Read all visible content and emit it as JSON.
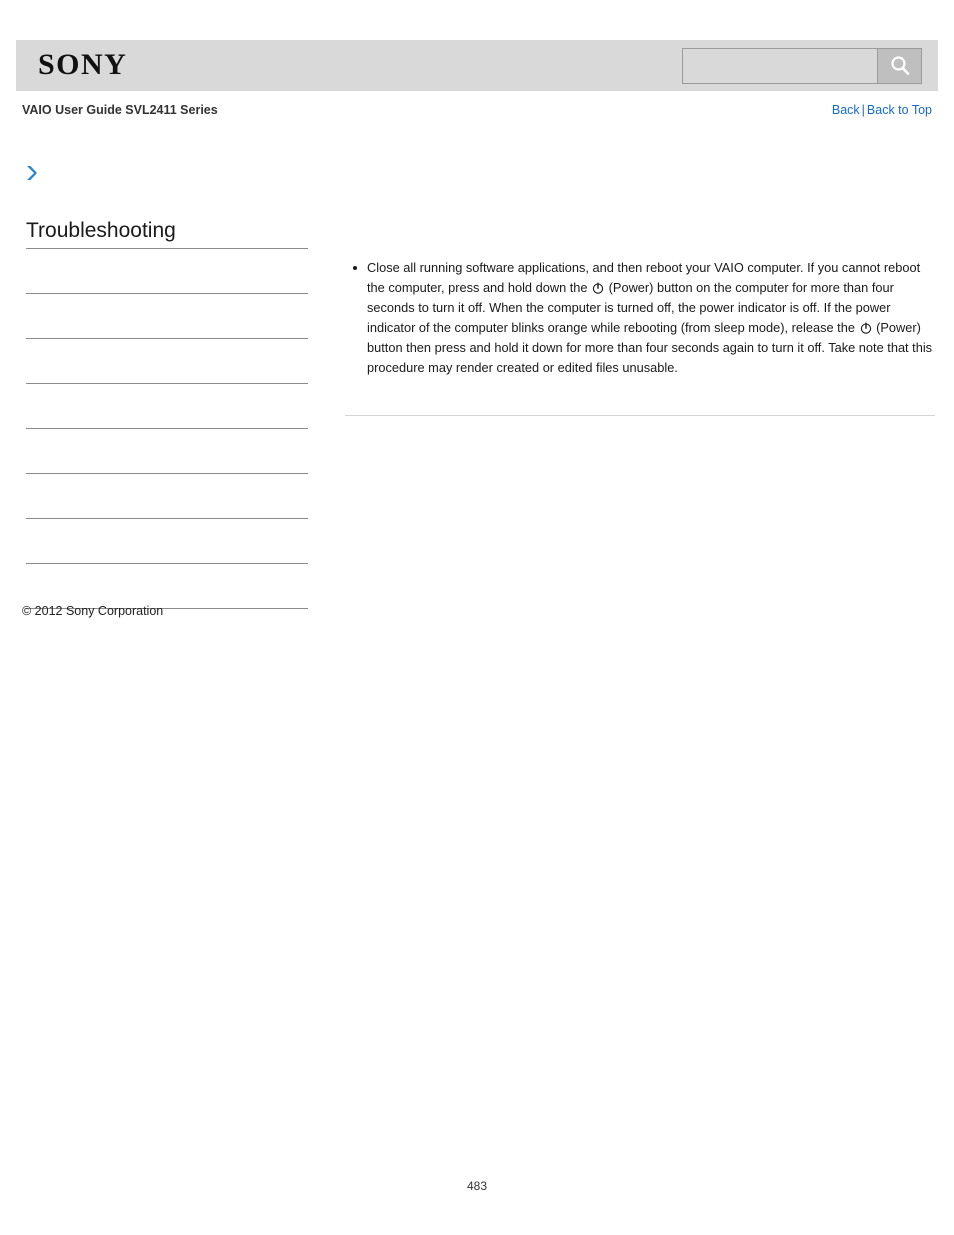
{
  "header": {
    "logo_text": "SONY",
    "logo_icon": "sony-wordmark",
    "search": {
      "value": "",
      "placeholder": "",
      "button_icon": "search-icon"
    }
  },
  "title_bar": {
    "guide_title": "VAIO User Guide SVL2411 Series",
    "links": {
      "back": "Back",
      "separator": "|",
      "back_to_top": "Back to Top"
    }
  },
  "breadcrumb": {
    "icon": "chevron-right-icon",
    "text": ""
  },
  "sidebar": {
    "heading": "Troubleshooting",
    "items": [
      {
        "label": ""
      },
      {
        "label": ""
      },
      {
        "label": ""
      },
      {
        "label": ""
      },
      {
        "label": ""
      },
      {
        "label": ""
      },
      {
        "label": ""
      },
      {
        "label": ""
      }
    ]
  },
  "footer": {
    "copyright": "© 2012 Sony Corporation",
    "page_number": "483"
  },
  "main": {
    "bullets": [
      {
        "part1": "Close all running software applications, and then reboot your VAIO computer. If you cannot reboot the computer, press and hold down the ",
        "icon1": "power-icon",
        "part2": " (Power) button on the computer for more than four seconds to turn it off. When the computer is turned off, the power indicator is off. If the power indicator of the computer blinks orange while rebooting (from sleep mode), release the ",
        "icon2": "power-icon",
        "part3": " (Power) button then press and hold it down for more than four seconds again to turn it off. Take note that this procedure may render created or edited files unusable."
      }
    ]
  },
  "colors": {
    "header_band": "#d9d9d9",
    "link_blue": "#1569c7",
    "chevron_blue": "#2e86c8",
    "rule_gray": "#8a8a8a",
    "content_rule": "#d4d4d4"
  }
}
